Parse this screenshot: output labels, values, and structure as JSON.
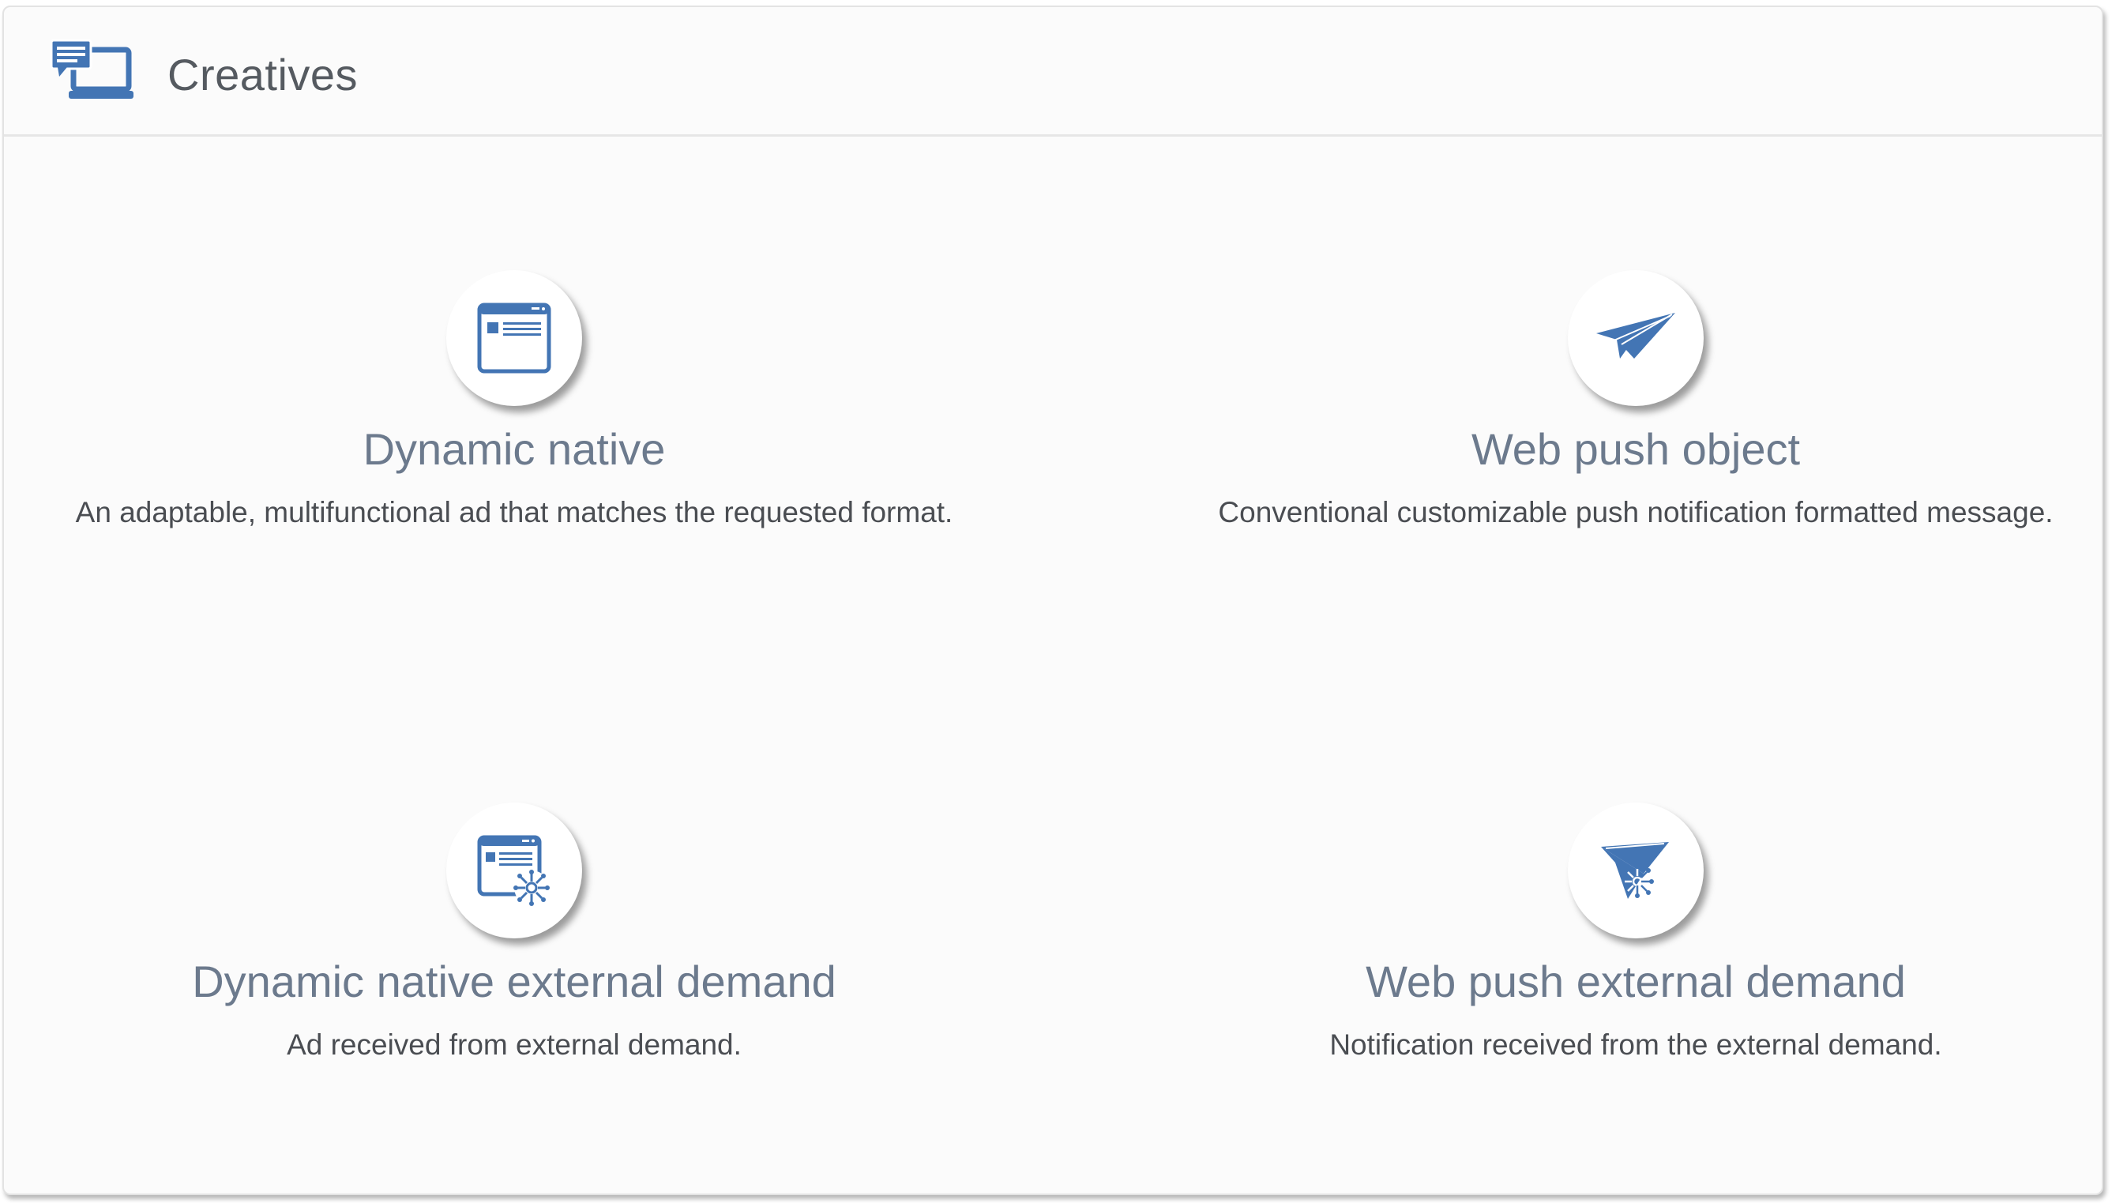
{
  "header": {
    "title": "Creatives",
    "icon": "monitor-chat-icon"
  },
  "colors": {
    "accent": "#4375b4",
    "title_gray": "#6c7a8d",
    "text_dark": "#4a4d52"
  },
  "cards": [
    {
      "title": "Dynamic native",
      "description": "An adaptable, multifunctional ad that matches the requested format.",
      "icon": "browser-window-icon"
    },
    {
      "title": "Web push object",
      "description": "Conventional customizable push notification formatted message.",
      "icon": "paper-plane-icon"
    },
    {
      "title": "Dynamic native external demand",
      "description": "Ad received from external demand.",
      "icon": "browser-window-network-icon"
    },
    {
      "title": "Web push external demand",
      "description": "Notification received from the external demand.",
      "icon": "paper-plane-network-icon"
    }
  ]
}
